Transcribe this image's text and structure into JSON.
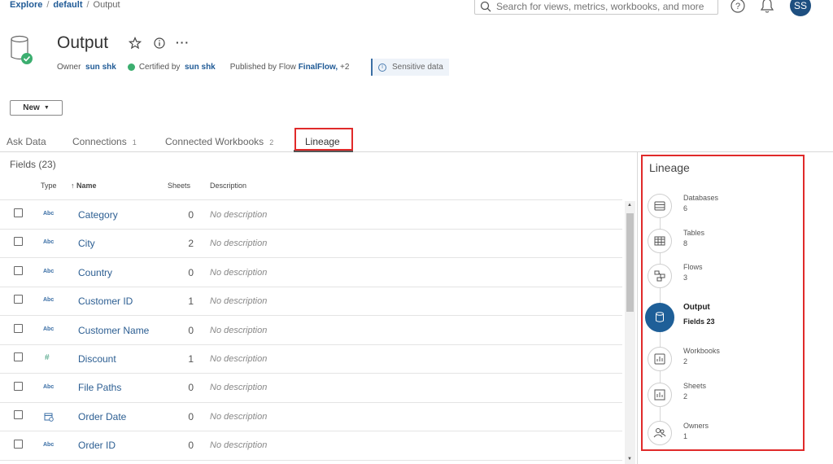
{
  "breadcrumb": {
    "root": "Explore",
    "project": "default",
    "current": "Output",
    "separator": "/"
  },
  "search": {
    "placeholder": "Search for views, metrics, workbooks, and more"
  },
  "user": {
    "initials": "SS"
  },
  "header": {
    "title": "Output",
    "owner_label": "Owner",
    "owner_name": "sun shk",
    "certified_label": "Certified by",
    "certified_name": "sun shk",
    "published_label": "Published by Flow",
    "flow_name": "FinalFlow,",
    "flow_more": "+2",
    "sensitive_label": "Sensitive data",
    "more_label": "···"
  },
  "new_button": {
    "label": "New"
  },
  "tabs": [
    {
      "label": "Ask Data",
      "count": ""
    },
    {
      "label": "Connections",
      "count": "1"
    },
    {
      "label": "Connected Workbooks",
      "count": "2"
    },
    {
      "label": "Lineage",
      "count": ""
    }
  ],
  "fields": {
    "title": "Fields (23)",
    "columns": {
      "type": "Type",
      "name": "Name",
      "sheets": "Sheets",
      "description": "Description"
    },
    "sort_arrow": "↑",
    "rows": [
      {
        "type": "Abc",
        "name": "Category",
        "sheets": "0",
        "description": "No description"
      },
      {
        "type": "Abc",
        "name": "City",
        "sheets": "2",
        "description": "No description"
      },
      {
        "type": "Abc",
        "name": "Country",
        "sheets": "0",
        "description": "No description"
      },
      {
        "type": "Abc",
        "name": "Customer ID",
        "sheets": "1",
        "description": "No description"
      },
      {
        "type": "Abc",
        "name": "Customer Name",
        "sheets": "0",
        "description": "No description"
      },
      {
        "type": "#",
        "name": "Discount",
        "sheets": "1",
        "description": "No description"
      },
      {
        "type": "Abc",
        "name": "File Paths",
        "sheets": "0",
        "description": "No description"
      },
      {
        "type": "date",
        "name": "Order Date",
        "sheets": "0",
        "description": "No description"
      },
      {
        "type": "Abc",
        "name": "Order ID",
        "sheets": "0",
        "description": "No description"
      }
    ]
  },
  "lineage": {
    "title": "Lineage",
    "nodes": [
      {
        "name": "Databases",
        "count": "6",
        "icon": "database-icon"
      },
      {
        "name": "Tables",
        "count": "8",
        "icon": "table-icon"
      },
      {
        "name": "Flows",
        "count": "3",
        "icon": "flow-icon"
      },
      {
        "name": "Output",
        "count": "Fields 23",
        "icon": "datasource-icon"
      },
      {
        "name": "Workbooks",
        "count": "2",
        "icon": "workbook-icon"
      },
      {
        "name": "Sheets",
        "count": "2",
        "icon": "sheet-icon"
      },
      {
        "name": "Owners",
        "count": "1",
        "icon": "owners-icon"
      }
    ]
  },
  "colors": {
    "accent": "#1e5f98",
    "link": "#2c5e92",
    "highlight_box": "#e02a2a",
    "certified": "#3bae6f"
  }
}
